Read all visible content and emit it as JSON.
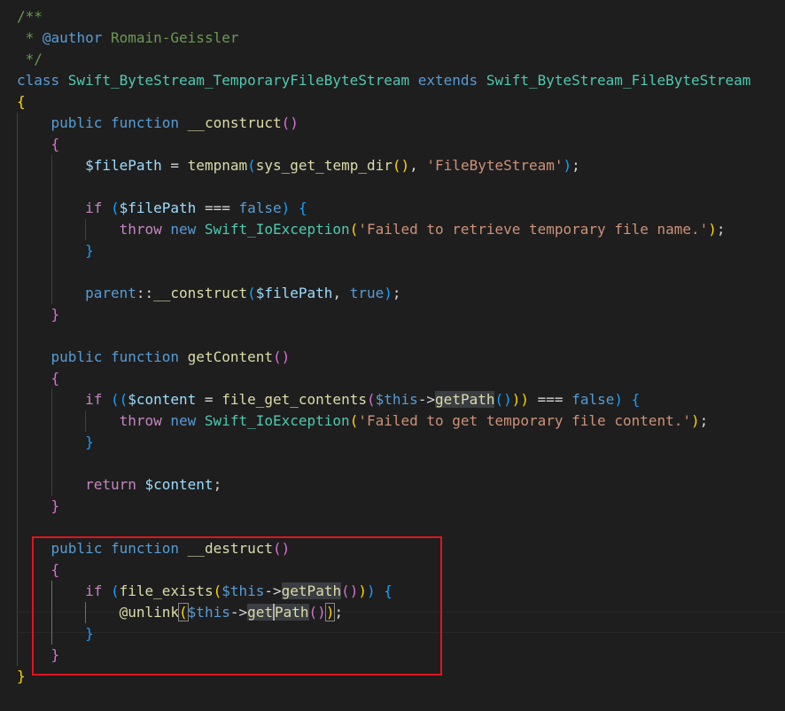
{
  "theme": {
    "background": "#1e1e1e",
    "colors": {
      "text": "#d4d4d4",
      "comment": "#6a9955",
      "keyword": "#569cd6",
      "control": "#c586c0",
      "function": "#dcdcaa",
      "string": "#ce9178",
      "variable": "#9cdcfe",
      "class": "#4ec9b0",
      "bracket1": "#ffd700",
      "bracket2": "#da70d6",
      "bracket3": "#179fff",
      "annotation": "#e0141e"
    }
  },
  "editor": {
    "language": "PHP",
    "annotation_box": "red rectangle around the __destruct method",
    "lines": [
      [
        [
          "/**",
          "comment"
        ]
      ],
      [
        [
          " * ",
          "comment"
        ],
        [
          "@author",
          "keyword"
        ],
        [
          " Romain-Geissler",
          "comment"
        ]
      ],
      [
        [
          " */",
          "comment"
        ]
      ],
      [
        [
          "class ",
          "keyword"
        ],
        [
          "Swift_ByteStream_TemporaryFileByteStream",
          "class"
        ],
        [
          " extends ",
          "keyword"
        ],
        [
          "Swift_ByteStream_FileByteStream",
          "class"
        ]
      ],
      [
        [
          "{",
          "bracket1"
        ]
      ],
      [
        [
          "    ",
          ""
        ],
        [
          "public ",
          "keyword"
        ],
        [
          "function ",
          "keyword"
        ],
        [
          "__construct",
          "function"
        ],
        [
          "()",
          "bracket2"
        ]
      ],
      [
        [
          "    ",
          ""
        ],
        [
          "{",
          "bracket2"
        ]
      ],
      [
        [
          "        ",
          ""
        ],
        [
          "$filePath",
          "variable"
        ],
        [
          " = ",
          ""
        ],
        [
          "tempnam",
          "function"
        ],
        [
          "(",
          "bracket3"
        ],
        [
          "sys_get_temp_dir",
          "function"
        ],
        [
          "()",
          "bracket1"
        ],
        [
          ", ",
          ""
        ],
        [
          "'FileByteStream'",
          "string"
        ],
        [
          ")",
          "bracket3"
        ],
        [
          ";",
          ""
        ]
      ],
      [],
      [
        [
          "        ",
          ""
        ],
        [
          "if ",
          "control"
        ],
        [
          "(",
          "bracket3"
        ],
        [
          "$filePath",
          "variable"
        ],
        [
          " === ",
          ""
        ],
        [
          "false",
          "keyword"
        ],
        [
          ")",
          "bracket3"
        ],
        [
          " ",
          ""
        ],
        [
          "{",
          "bracket3"
        ]
      ],
      [
        [
          "            ",
          ""
        ],
        [
          "throw ",
          "control"
        ],
        [
          "new ",
          "keyword"
        ],
        [
          "Swift_IoException",
          "class"
        ],
        [
          "(",
          "bracket1"
        ],
        [
          "'Failed to retrieve temporary file name.'",
          "string"
        ],
        [
          ")",
          "bracket1"
        ],
        [
          ";",
          ""
        ]
      ],
      [
        [
          "        ",
          ""
        ],
        [
          "}",
          "bracket3"
        ]
      ],
      [],
      [
        [
          "        ",
          ""
        ],
        [
          "parent",
          "keyword"
        ],
        [
          "::",
          ""
        ],
        [
          "__construct",
          "function"
        ],
        [
          "(",
          "bracket3"
        ],
        [
          "$filePath",
          "variable"
        ],
        [
          ", ",
          ""
        ],
        [
          "true",
          "keyword"
        ],
        [
          ")",
          "bracket3"
        ],
        [
          ";",
          ""
        ]
      ],
      [
        [
          "    ",
          ""
        ],
        [
          "}",
          "bracket2"
        ]
      ],
      [],
      [
        [
          "    ",
          ""
        ],
        [
          "public ",
          "keyword"
        ],
        [
          "function ",
          "keyword"
        ],
        [
          "getContent",
          "function"
        ],
        [
          "()",
          "bracket2"
        ]
      ],
      [
        [
          "    ",
          ""
        ],
        [
          "{",
          "bracket2"
        ]
      ],
      [
        [
          "        ",
          ""
        ],
        [
          "if ",
          "control"
        ],
        [
          "((",
          "bracket3"
        ],
        [
          "$content",
          "variable"
        ],
        [
          " = ",
          ""
        ],
        [
          "file_get_contents",
          "function"
        ],
        [
          "(",
          "bracket2"
        ],
        [
          "$this",
          "keyword"
        ],
        [
          "->",
          ""
        ],
        [
          "getPath",
          "function",
          "hl"
        ],
        [
          "()",
          "bracket3"
        ],
        [
          "))",
          "bracket1"
        ],
        [
          " === ",
          ""
        ],
        [
          "false",
          "keyword"
        ],
        [
          ")",
          "bracket3"
        ],
        [
          " ",
          ""
        ],
        [
          "{",
          "bracket3"
        ]
      ],
      [
        [
          "            ",
          ""
        ],
        [
          "throw ",
          "control"
        ],
        [
          "new ",
          "keyword"
        ],
        [
          "Swift_IoException",
          "class"
        ],
        [
          "(",
          "bracket1"
        ],
        [
          "'Failed to get temporary file content.'",
          "string"
        ],
        [
          ")",
          "bracket1"
        ],
        [
          ";",
          ""
        ]
      ],
      [
        [
          "        ",
          ""
        ],
        [
          "}",
          "bracket3"
        ]
      ],
      [],
      [
        [
          "        ",
          ""
        ],
        [
          "return ",
          "control"
        ],
        [
          "$content",
          "variable"
        ],
        [
          ";",
          ""
        ]
      ],
      [
        [
          "    ",
          ""
        ],
        [
          "}",
          "bracket2"
        ]
      ],
      [],
      [
        [
          "    ",
          ""
        ],
        [
          "public ",
          "keyword"
        ],
        [
          "function ",
          "keyword"
        ],
        [
          "__destruct",
          "function"
        ],
        [
          "()",
          "bracket2"
        ]
      ],
      [
        [
          "    ",
          ""
        ],
        [
          "{",
          "bracket2"
        ]
      ],
      [
        [
          "        ",
          ""
        ],
        [
          "if ",
          "control"
        ],
        [
          "(",
          "bracket3"
        ],
        [
          "file_exists",
          "function"
        ],
        [
          "(",
          "bracket1"
        ],
        [
          "$this",
          "keyword"
        ],
        [
          "->",
          ""
        ],
        [
          "getPath",
          "function",
          "hl"
        ],
        [
          "()",
          "bracket2"
        ],
        [
          ")",
          "bracket1"
        ],
        [
          ")",
          "bracket3"
        ],
        [
          " ",
          ""
        ],
        [
          "{",
          "bracket3"
        ]
      ],
      [
        [
          "            ",
          ""
        ],
        [
          "@unlink",
          "function"
        ],
        [
          "(",
          "bracket1",
          "bm"
        ],
        [
          "$this",
          "keyword"
        ],
        [
          "->",
          ""
        ],
        [
          "get",
          "function",
          "hl"
        ],
        [
          "Path",
          "function",
          "hl caret"
        ],
        [
          "()",
          "bracket2"
        ],
        [
          ")",
          "bracket1",
          "bm"
        ],
        [
          ";",
          ""
        ]
      ],
      [
        [
          "        ",
          ""
        ],
        [
          "}",
          "bracket3"
        ]
      ],
      [
        [
          "    ",
          ""
        ],
        [
          "}",
          "bracket2"
        ]
      ],
      [
        [
          "}",
          "bracket1"
        ]
      ]
    ]
  }
}
